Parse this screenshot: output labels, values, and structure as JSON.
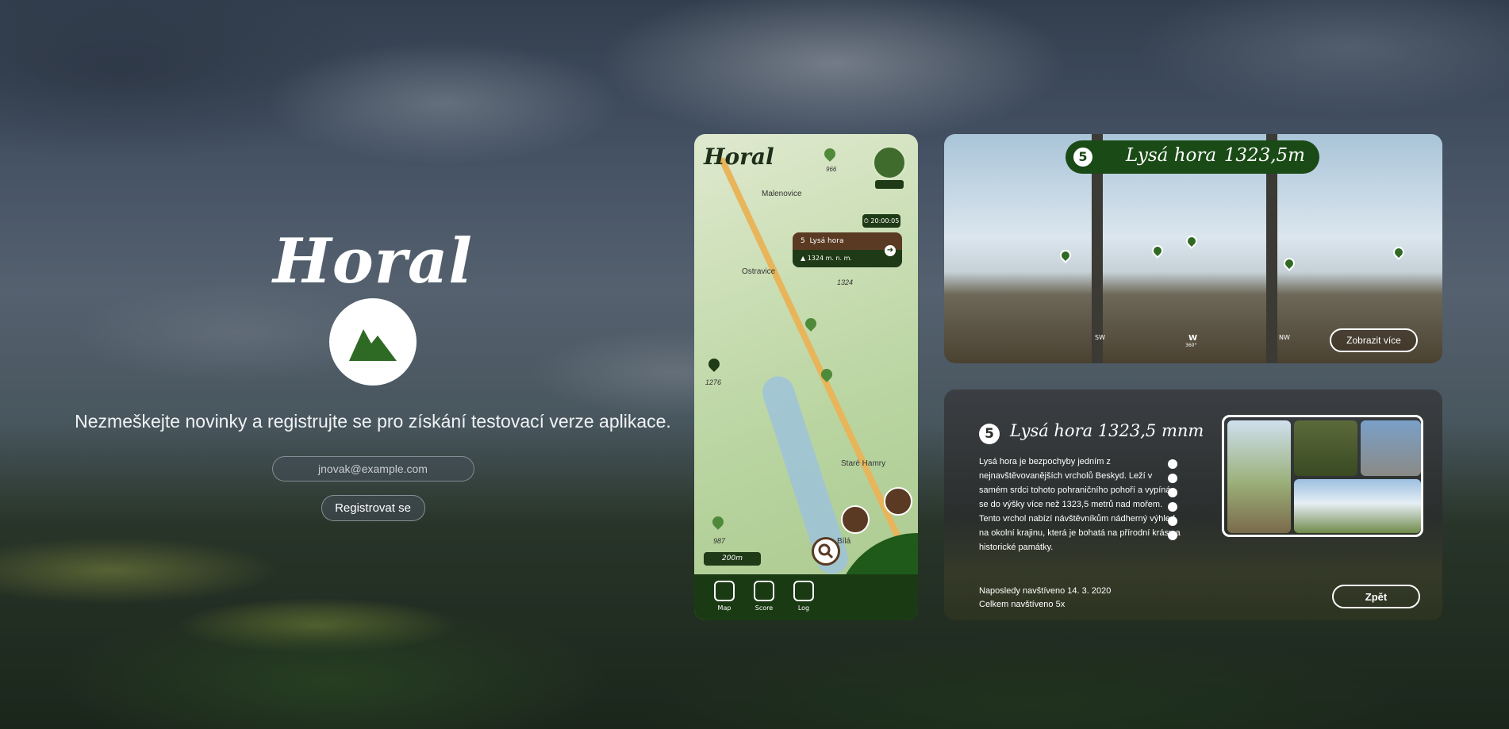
{
  "hero": {
    "brand": "Horal",
    "tagline": "Nezmeškejte novinky a registrujte se pro získání testovací verze aplikace.",
    "email_placeholder": "jnovak@example.com",
    "register_label": "Registrovat se"
  },
  "phone": {
    "app_title": "Horal",
    "timer": "20:00:05",
    "pin_card": {
      "number": "5",
      "name": "Lysá hora",
      "altitude": "1324 m. n. m."
    },
    "map_labels": [
      "Malenovice",
      "Ostravice",
      "Staré Hamry",
      "Bílá",
      "1324",
      "1276",
      "987",
      "966"
    ],
    "scale": "200m",
    "nav": [
      {
        "label": "Map"
      },
      {
        "label": "Score"
      },
      {
        "label": "Log"
      }
    ]
  },
  "ar_view": {
    "number": "5",
    "name": "Lysá hora",
    "altitude": "1323,5m",
    "compass": {
      "left": "SW",
      "center": "W",
      "degrees": "360°",
      "right": "NW"
    },
    "more_label": "Zobrazit více"
  },
  "detail": {
    "number": "5",
    "title": "Lysá hora 1323,5 mnm",
    "description": "Lysá hora je bezpochyby jedním z nejnavštěvovanějších vrcholů Beskyd. Leží v samém srdci tohoto pohraničního pohoří a vypíná se do výšky více než 1323,5 metrů nad mořem. Tento vrchol nabízí návštěvníkům nádherný výhled na okolní krajinu, která je bohatá na přírodní krásy a historické památky.",
    "last_visit": "Naposledy navštíveno 14. 3. 2020",
    "visit_count": "Celkem navštíveno 5x",
    "back_label": "Zpět"
  },
  "colors": {
    "brand_green": "#1a4a16",
    "brown": "#5a3a22",
    "white": "#ffffff"
  }
}
